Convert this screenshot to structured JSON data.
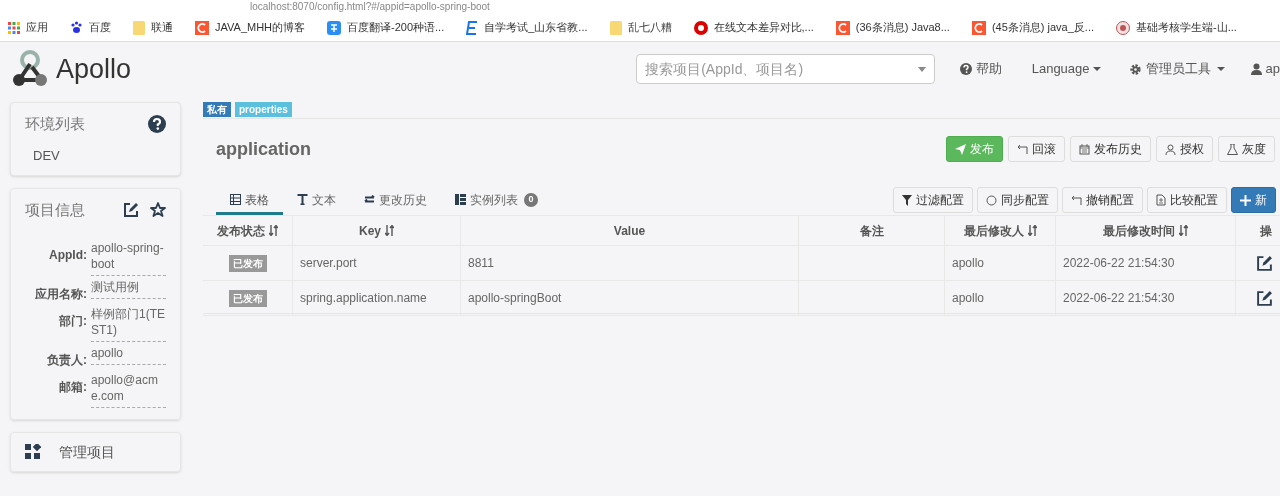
{
  "browser": {
    "url": "localhost:8070/config.html?#/appid=apollo-spring-boot",
    "bookmarks": [
      {
        "label": "应用",
        "kind": "apps"
      },
      {
        "label": "百度",
        "kind": "paw"
      },
      {
        "label": "联通",
        "kind": "folder"
      },
      {
        "label": "JAVA_MHH的博客",
        "kind": "csdn"
      },
      {
        "label": "百度翻译-200种语...",
        "kind": "translate"
      },
      {
        "label": "自学考试_山东省教...",
        "kind": "e"
      },
      {
        "label": "乱七八糟",
        "kind": "folder"
      },
      {
        "label": "在线文本差异对比,...",
        "kind": "target"
      },
      {
        "label": "(36条消息) Java8...",
        "kind": "csdn"
      },
      {
        "label": "(45条消息) java_反...",
        "kind": "csdn"
      },
      {
        "label": "基础考核学生端-山...",
        "kind": "seal"
      }
    ]
  },
  "header": {
    "logo": "Apollo",
    "search": {
      "placeholder": "搜索项目(AppId、项目名)"
    },
    "help": "帮助",
    "language": "Language",
    "admin": "管理员工具",
    "user": "ap"
  },
  "sidebar": {
    "env_title": "环境列表",
    "envs": [
      "DEV"
    ],
    "info_title": "项目信息",
    "info": [
      {
        "label": "AppId:",
        "value": "apollo-spring-boot"
      },
      {
        "label": "应用名称:",
        "value": "测试用例"
      },
      {
        "label": "部门:",
        "value": "样例部门1(TEST1)"
      },
      {
        "label": "负责人:",
        "value": "apollo"
      },
      {
        "label": "邮箱:",
        "value": "apollo@acme.com"
      }
    ],
    "manage": "管理项目"
  },
  "namespace": {
    "badges": [
      {
        "text": "私有",
        "color": "#337ab7"
      },
      {
        "text": "properties",
        "color": "#5bc0de"
      }
    ],
    "title": "application",
    "actions": [
      {
        "label": "发布",
        "kind": "primary"
      },
      {
        "label": "回滚",
        "kind": "rollback"
      },
      {
        "label": "发布历史",
        "kind": "history"
      },
      {
        "label": "授权",
        "kind": "user"
      },
      {
        "label": "灰度",
        "kind": "flask"
      }
    ],
    "tabs": [
      {
        "label": "表格",
        "kind": "table",
        "selected": true
      },
      {
        "label": "文本",
        "kind": "text",
        "selected": false
      },
      {
        "label": "更改历史",
        "kind": "swap",
        "selected": false
      },
      {
        "label": "实例列表",
        "kind": "instances",
        "selected": false,
        "count": "0"
      }
    ],
    "tools": [
      {
        "label": "过滤配置",
        "kind": "filter"
      },
      {
        "label": "同步配置",
        "kind": "sync"
      },
      {
        "label": "撤销配置",
        "kind": "rollback"
      },
      {
        "label": "比较配置",
        "kind": "compare"
      },
      {
        "label": "新",
        "kind": "add"
      }
    ],
    "table": {
      "columns": [
        {
          "label": "发布状态",
          "sortable": true
        },
        {
          "label": "Key",
          "sortable": true
        },
        {
          "label": "Value",
          "sortable": false
        },
        {
          "label": "备注",
          "sortable": false
        },
        {
          "label": "最后修改人",
          "sortable": true
        },
        {
          "label": "最后修改时间",
          "sortable": true
        },
        {
          "label": "操",
          "sortable": false
        }
      ],
      "rows": [
        {
          "status": "已发布",
          "key": "server.port",
          "value": "8811",
          "comment": "",
          "modifier": "apollo",
          "time": "2022-06-22 21:54:30"
        },
        {
          "status": "已发布",
          "key": "spring.application.name",
          "value": "apollo-springBoot",
          "comment": "",
          "modifier": "apollo",
          "time": "2022-06-22 21:54:30"
        }
      ]
    }
  }
}
